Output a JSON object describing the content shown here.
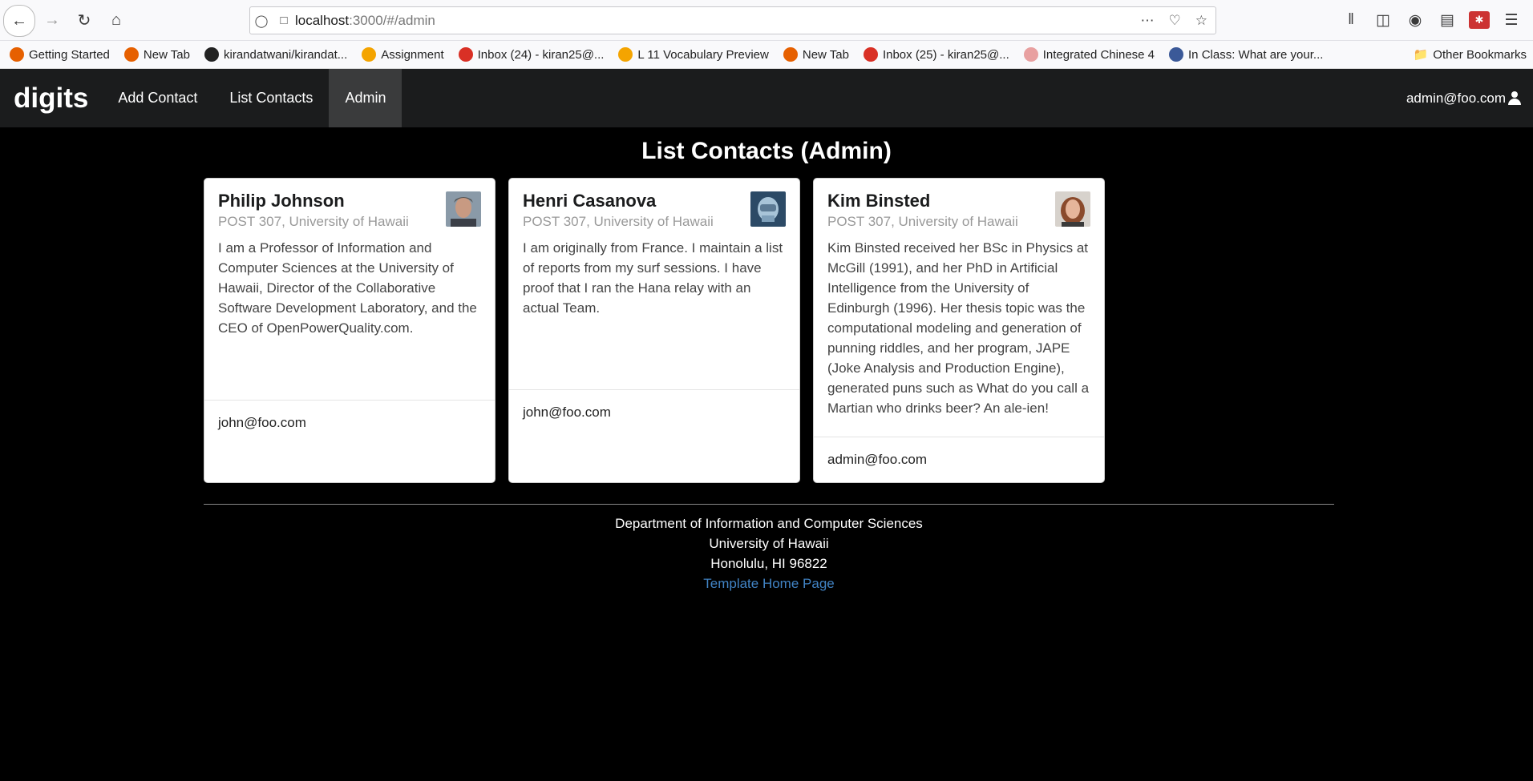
{
  "browser": {
    "url_host": "localhost",
    "url_path": ":3000/#/admin",
    "bookmarks": [
      {
        "label": "Getting Started",
        "color": "#e66000"
      },
      {
        "label": "New Tab",
        "color": "#e66000"
      },
      {
        "label": "kirandatwani/kirandat...",
        "color": "#222222"
      },
      {
        "label": "Assignment",
        "color": "#f4a400"
      },
      {
        "label": "Inbox (24) - kiran25@...",
        "color": "#d93025"
      },
      {
        "label": "L 11 Vocabulary Preview",
        "color": "#f4a400"
      },
      {
        "label": "New Tab",
        "color": "#e66000"
      },
      {
        "label": "Inbox (25) - kiran25@...",
        "color": "#d93025"
      },
      {
        "label": "Integrated Chinese 4",
        "color": "#e8a0a0"
      },
      {
        "label": "In Class: What are your...",
        "color": "#3b5998"
      }
    ],
    "other_bookmarks": "Other Bookmarks"
  },
  "navbar": {
    "brand": "digits",
    "items": [
      {
        "label": "Add Contact",
        "active": false
      },
      {
        "label": "List Contacts",
        "active": false
      },
      {
        "label": "Admin",
        "active": true
      }
    ],
    "user": "admin@foo.com"
  },
  "page": {
    "title": "List Contacts (Admin)"
  },
  "contacts": [
    {
      "name": "Philip Johnson",
      "address": "POST 307, University of Hawaii",
      "description": "I am a Professor of Information and Computer Sciences at the University of Hawaii, Director of the Collaborative Software Development Laboratory, and the CEO of OpenPowerQuality.com.",
      "owner": "john@foo.com"
    },
    {
      "name": "Henri Casanova",
      "address": "POST 307, University of Hawaii",
      "description": "I am originally from France. I maintain a list of reports from my surf sessions. I have proof that I ran the Hana relay with an actual Team.",
      "owner": "john@foo.com"
    },
    {
      "name": "Kim Binsted",
      "address": "POST 307, University of Hawaii",
      "description": "Kim Binsted received her BSc in Physics at McGill (1991), and her PhD in Artificial Intelligence from the University of Edinburgh (1996). Her thesis topic was the computational modeling and generation of punning riddles, and her program, JAPE (Joke Analysis and Production Engine), generated puns such as What do you call a Martian who drinks beer? An ale-ien!",
      "owner": "admin@foo.com"
    }
  ],
  "footer": {
    "line1": "Department of Information and Computer Sciences",
    "line2": "University of Hawaii",
    "line3": "Honolulu, HI 96822",
    "link": "Template Home Page"
  }
}
